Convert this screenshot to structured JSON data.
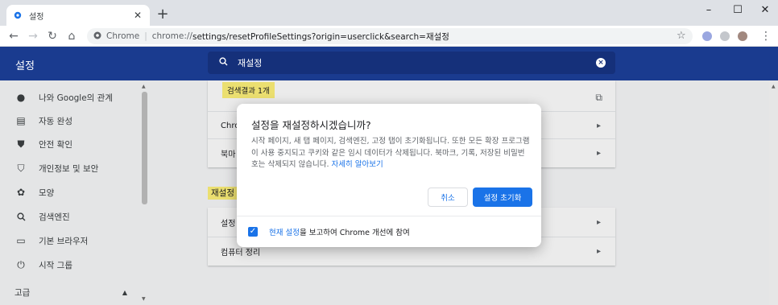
{
  "browser": {
    "tab_title": "설정",
    "new_tab": "+",
    "url_origin_label": "Chrome",
    "url_host": "chrome://",
    "url_path": "settings/resetProfileSettings?origin=userclick&search=재설정"
  },
  "header": {
    "title": "설정",
    "search_value": "재설정"
  },
  "sidebar": {
    "items": [
      {
        "label": "나와 Google의 관계",
        "icon": "person-icon"
      },
      {
        "label": "자동 완성",
        "icon": "clipboard-icon"
      },
      {
        "label": "안전 확인",
        "icon": "shield-check-icon"
      },
      {
        "label": "개인정보 및 보안",
        "icon": "shield-icon"
      },
      {
        "label": "모양",
        "icon": "palette-icon"
      },
      {
        "label": "검색엔진",
        "icon": "search-icon"
      },
      {
        "label": "기본 브라우저",
        "icon": "browser-icon"
      },
      {
        "label": "시작 그룹",
        "icon": "power-icon"
      }
    ],
    "advanced_label": "고급"
  },
  "content": {
    "result_bubble": "검색결과 1개",
    "row_chrome": "Chro",
    "row_bookmark": "북마",
    "section_title": "재설정",
    "row_settings": "설정",
    "row_cleanup": "컴퓨터 정리"
  },
  "dialog": {
    "title": "설정을 재설정하시겠습니까?",
    "body": "시작 페이지, 새 탭 페이지, 검색엔진, 고정 탭이 초기화됩니다. 또한 모든 확장 프로그램이 사용 중지되고 쿠키와 같은 임시 데이터가 삭제됩니다. 북마크, 기록, 저장된 비밀번호는 삭제되지 않습니다.",
    "learn_more": "자세히 알아보기",
    "cancel": "취소",
    "reset": "설정 초기화",
    "checkbox_link": "현재 설정",
    "checkbox_text": "을 보고하여 Chrome 개선에 참여"
  },
  "colors": {
    "header_bg": "#1a3b8f",
    "accent": "#1a73e8",
    "highlight": "#fff27a"
  }
}
